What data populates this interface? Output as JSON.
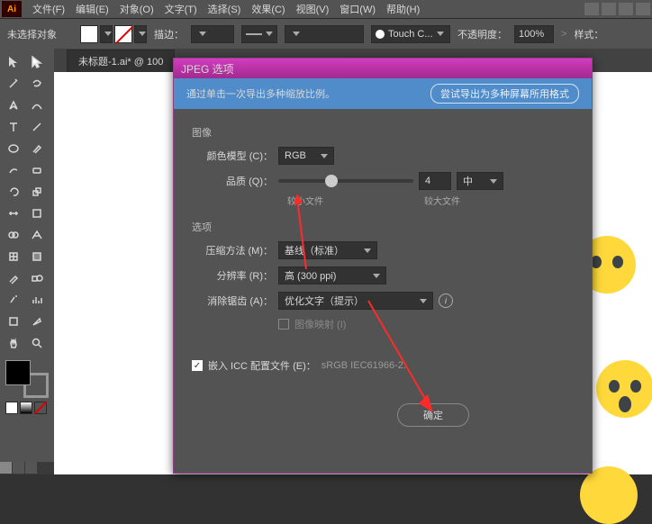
{
  "menu": {
    "items": [
      "文件(F)",
      "编辑(E)",
      "对象(O)",
      "文字(T)",
      "选择(S)",
      "效果(C)",
      "视图(V)",
      "窗口(W)",
      "帮助(H)"
    ]
  },
  "options": {
    "no_selection": "未选择对象",
    "stroke_label": "描边：",
    "touch": "Touch C...",
    "opacity_label": "不透明度：",
    "opacity_value": "100%",
    "style_label": "样式："
  },
  "tab": "未标题-1.ai* @ 100",
  "dialog": {
    "title": "JPEG 选项",
    "tip": "通过单击一次导出多种缩放比例。",
    "tip_btn": "尝试导出为多种屏幕所用格式",
    "sect_image": "图像",
    "color_model_label": "颜色模型 (C)：",
    "color_model_value": "RGB",
    "quality_label": "品质 (Q)：",
    "quality_value": "4",
    "quality_sel": "中",
    "small_file": "较小文件",
    "large_file": "较大文件",
    "sect_options": "选项",
    "compress_label": "压缩方法 (M)：",
    "compress_value": "基线（标准）",
    "res_label": "分辨率 (R)：",
    "res_value": "高 (300 ppi)",
    "aa_label": "消除锯齿 (A)：",
    "aa_value": "优化文字（提示）",
    "imagemap": "图像映射 (I)",
    "icc": "嵌入 ICC 配置文件 (E)：",
    "icc_value": "sRGB IEC61966-2.",
    "ok": "确定"
  }
}
